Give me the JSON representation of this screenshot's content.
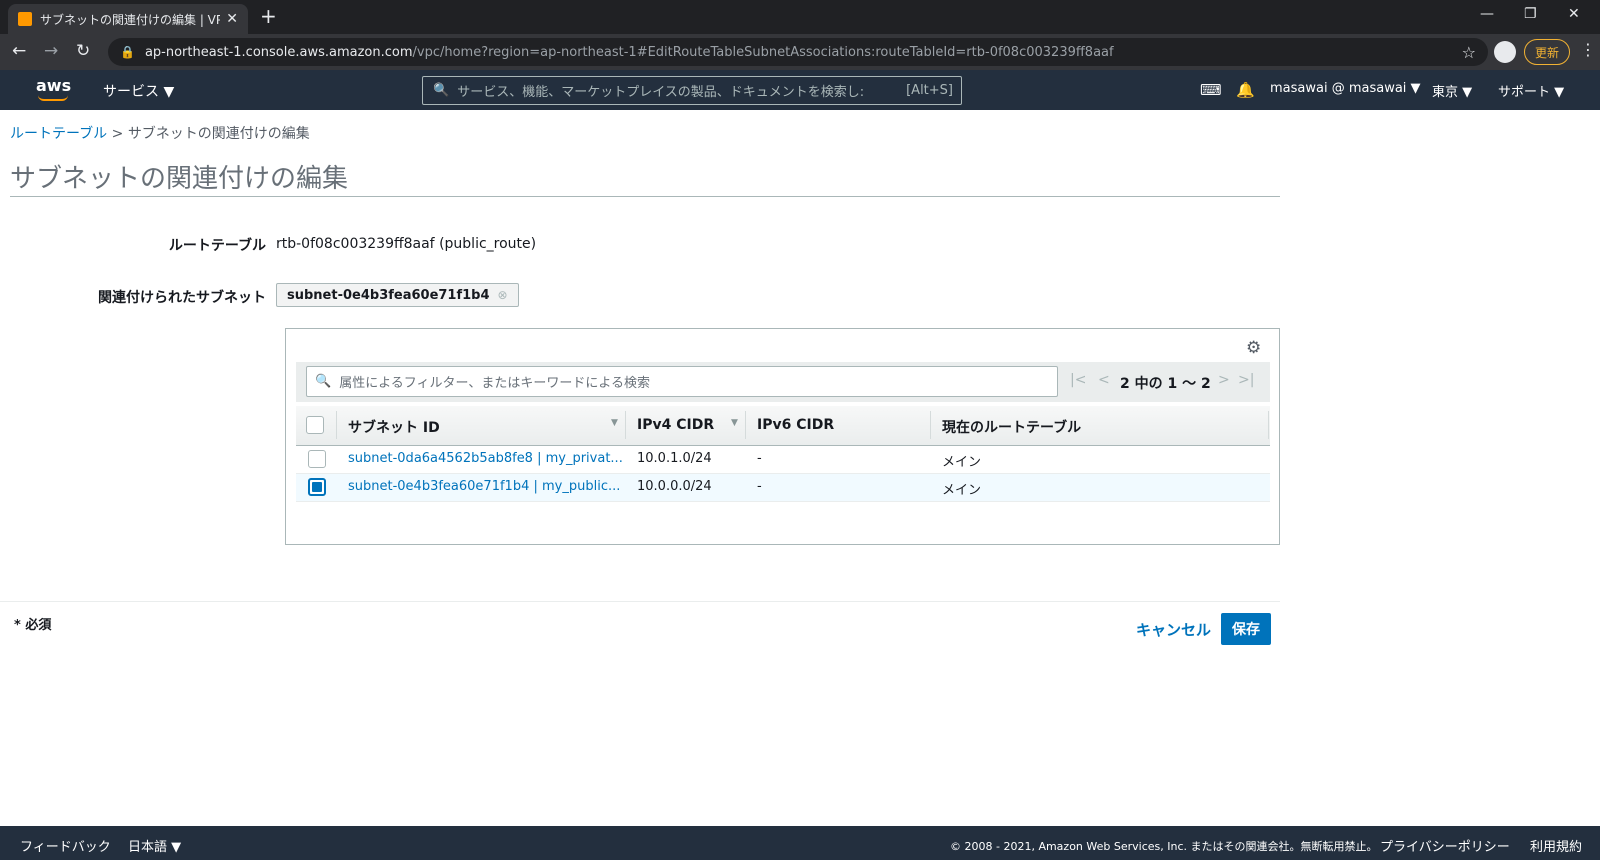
{
  "browser": {
    "tab_title": "サブネットの関連付けの編集 | VPC M",
    "tab_close": "✕",
    "new_tab": "+",
    "minimize": "—",
    "restore": "❐",
    "close": "✕",
    "url_host": "ap-northeast-1.console.aws.amazon.com",
    "url_rest": "/vpc/home?region=ap-northeast-1#EditRouteTableSubnetAssociations:routeTableId=rtb-0f08c003239ff8aaf",
    "update_label": "更新"
  },
  "awsnav": {
    "logo": "aws",
    "services_label": "サービス ▼",
    "search_placeholder": "サービス、機能、マーケットプレイスの製品、ドキュメントを検索し:",
    "search_shortcut": "[Alt+S]",
    "user": "masawai @ masawai ▼",
    "region": "東京 ▼",
    "support": "サポート ▼"
  },
  "breadcrumb": {
    "parent": "ルートテーブル",
    "separator": ">",
    "current": "サブネットの関連付けの編集"
  },
  "page": {
    "title": "サブネットの関連付けの編集",
    "route_table_label": "ルートテーブル",
    "route_table_value": "rtb-0f08c003239ff8aaf (public_route)",
    "associated_label": "関連付けられたサブネット",
    "associated_token": "subnet-0e4b3fea60e71f1b4",
    "token_remove": "⊗"
  },
  "table": {
    "filter_placeholder": "属性によるフィルター、またはキーワードによる検索",
    "pagination": "2 中の 1 ～ 2",
    "columns": [
      "サブネット ID",
      "IPv4 CIDR",
      "IPv6 CIDR",
      "現在のルートテーブル"
    ],
    "rows": [
      {
        "subnet": "subnet-0da6a4562b5ab8fe8 | my_privat...",
        "ipv4": "10.0.1.0/24",
        "ipv6": "-",
        "route": "メイン",
        "checked": false
      },
      {
        "subnet": "subnet-0e4b3fea60e71f1b4 | my_public...",
        "ipv4": "10.0.0.0/24",
        "ipv6": "-",
        "route": "メイン",
        "checked": true
      }
    ]
  },
  "form": {
    "required": "* 必須",
    "cancel": "キャンセル",
    "save": "保存"
  },
  "footer": {
    "feedback": "フィードバック",
    "language": "日本語 ▼",
    "copyright": "© 2008 - 2021, Amazon Web Services, Inc. またはその関連会社。無断転用禁止。",
    "privacy": "プライバシーポリシー",
    "terms": "利用規約"
  },
  "colors": {
    "aws_nav": "#232f3e",
    "link": "#0073bb",
    "accent": "#ff9900"
  }
}
